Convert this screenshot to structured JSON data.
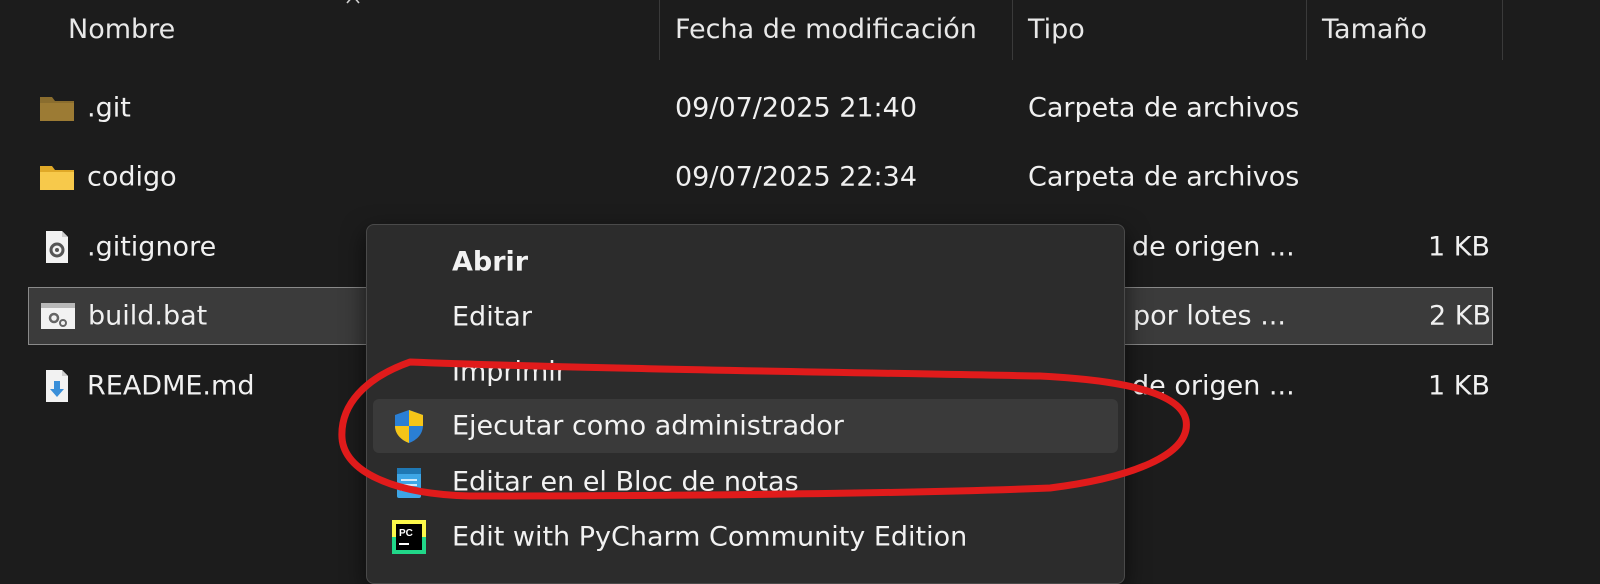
{
  "columns": {
    "name": "Nombre",
    "modified": "Fecha de modificación",
    "type": "Tipo",
    "size": "Tamaño"
  },
  "files": [
    {
      "name": ".git",
      "modified": "09/07/2025 21:40",
      "type": "Carpeta de archivos",
      "size": "",
      "icon": "folder-icon"
    },
    {
      "name": "codigo",
      "modified": "09/07/2025 22:34",
      "type": "Carpeta de archivos",
      "size": "",
      "icon": "folder-icon"
    },
    {
      "name": ".gitignore",
      "modified": "",
      "type": "de origen ...",
      "size": "1 KB",
      "icon": "settings-file-icon"
    },
    {
      "name": "build.bat",
      "modified": "",
      "type": "por lotes ...",
      "size": "2 KB",
      "icon": "batch-file-icon",
      "selected": true
    },
    {
      "name": "README.md",
      "modified": "",
      "type": "de origen ...",
      "size": "1 KB",
      "icon": "download-file-icon"
    }
  ],
  "context_menu": {
    "items": [
      {
        "label": "Abrir",
        "icon": "",
        "bold": true
      },
      {
        "label": "Editar",
        "icon": ""
      },
      {
        "label": "Imprimir",
        "icon": ""
      },
      {
        "label": "Ejecutar como administrador",
        "icon": "uac-shield-icon",
        "hover": true
      },
      {
        "label": "Editar en el Bloc de notas",
        "icon": "notepad-icon"
      },
      {
        "label": "Edit with PyCharm Community Edition",
        "icon": "pycharm-icon"
      }
    ]
  },
  "colors": {
    "background": "#1c1c1c",
    "menu_background": "#2c2c2c",
    "selection": "#3b3b3b",
    "annotation": "#e01b1b",
    "folder_yellow": "#f7c94b",
    "folder_dim": "#8a6d2e"
  }
}
